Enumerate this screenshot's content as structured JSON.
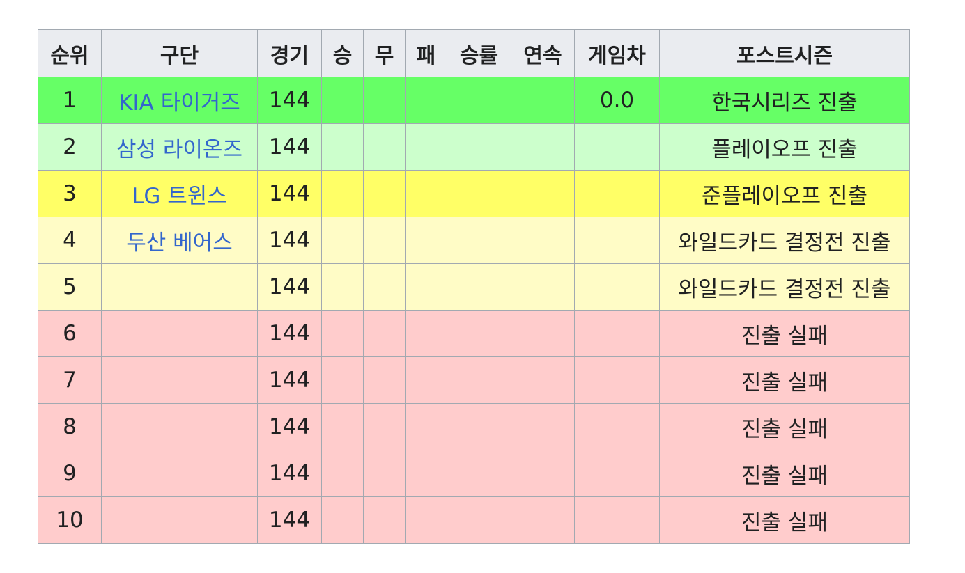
{
  "headers": [
    "순위",
    "구단",
    "경기",
    "승",
    "무",
    "패",
    "승률",
    "연속",
    "게임차",
    "포스트시즌"
  ],
  "rows": [
    {
      "rank": "1",
      "team": "KIA 타이거즈",
      "games": "144",
      "win": "",
      "draw": "",
      "loss": "",
      "pct": "",
      "streak": "",
      "gb": "0.0",
      "postseason": "한국시리즈 진출",
      "status": "ks"
    },
    {
      "rank": "2",
      "team": "삼성 라이온즈",
      "games": "144",
      "win": "",
      "draw": "",
      "loss": "",
      "pct": "",
      "streak": "",
      "gb": "",
      "postseason": "플레이오프 진출",
      "status": "po"
    },
    {
      "rank": "3",
      "team": "LG 트윈스",
      "games": "144",
      "win": "",
      "draw": "",
      "loss": "",
      "pct": "",
      "streak": "",
      "gb": "",
      "postseason": "준플레이오프 진출",
      "status": "spo"
    },
    {
      "rank": "4",
      "team": "두산 베어스",
      "games": "144",
      "win": "",
      "draw": "",
      "loss": "",
      "pct": "",
      "streak": "",
      "gb": "",
      "postseason": "와일드카드 결정전 진출",
      "status": "wc"
    },
    {
      "rank": "5",
      "team": "",
      "games": "144",
      "win": "",
      "draw": "",
      "loss": "",
      "pct": "",
      "streak": "",
      "gb": "",
      "postseason": "와일드카드 결정전 진출",
      "status": "wc"
    },
    {
      "rank": "6",
      "team": "",
      "games": "144",
      "win": "",
      "draw": "",
      "loss": "",
      "pct": "",
      "streak": "",
      "gb": "",
      "postseason": "진출 실패",
      "status": "out"
    },
    {
      "rank": "7",
      "team": "",
      "games": "144",
      "win": "",
      "draw": "",
      "loss": "",
      "pct": "",
      "streak": "",
      "gb": "",
      "postseason": "진출 실패",
      "status": "out"
    },
    {
      "rank": "8",
      "team": "",
      "games": "144",
      "win": "",
      "draw": "",
      "loss": "",
      "pct": "",
      "streak": "",
      "gb": "",
      "postseason": "진출 실패",
      "status": "out"
    },
    {
      "rank": "9",
      "team": "",
      "games": "144",
      "win": "",
      "draw": "",
      "loss": "",
      "pct": "",
      "streak": "",
      "gb": "",
      "postseason": "진출 실패",
      "status": "out"
    },
    {
      "rank": "10",
      "team": "",
      "games": "144",
      "win": "",
      "draw": "",
      "loss": "",
      "pct": "",
      "streak": "",
      "gb": "",
      "postseason": "진출 실패",
      "status": "out"
    }
  ],
  "colors": {
    "header_bg": "#eaecf0",
    "link": "#3366cc",
    "korean_series": "#66ff66",
    "playoff": "#ccffcc",
    "semi_playoff": "#ffff66",
    "wildcard": "#fffcc6",
    "eliminated": "#ffcccc",
    "border": "#a2a9b1"
  }
}
